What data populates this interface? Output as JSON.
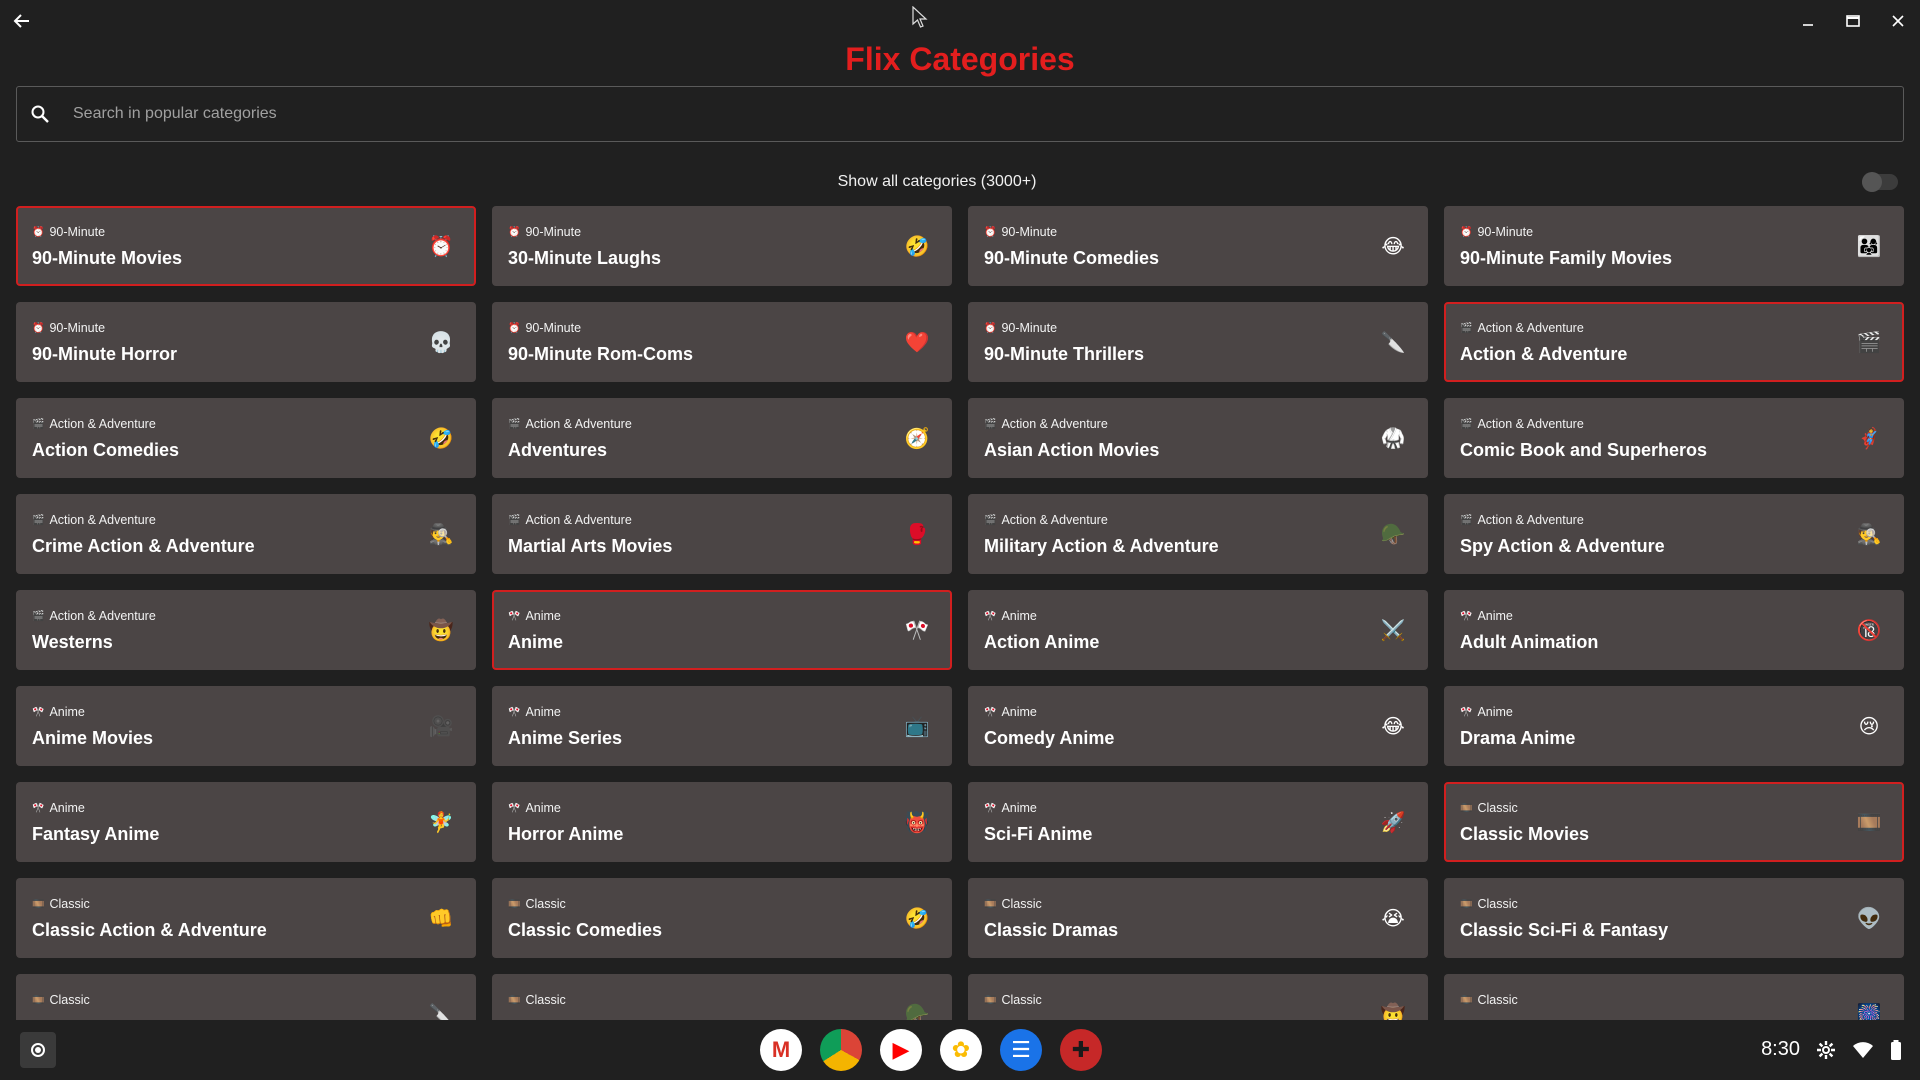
{
  "app": {
    "title": "Flix Categories"
  },
  "search": {
    "placeholder": "Search in popular categories"
  },
  "toggle": {
    "label": "Show all categories (3000+)",
    "on": false
  },
  "colors": {
    "accent": "#e31e1e",
    "card_bg": "#4b4545",
    "selected_border": "#d11f1f",
    "bg": "#202020"
  },
  "cards": [
    {
      "cat_icon": "⏰",
      "category": "90-Minute",
      "title": "90-Minute Movies",
      "emoji": "⏰",
      "icon_name": "alarm-clock-icon",
      "selected": true
    },
    {
      "cat_icon": "⏰",
      "category": "90-Minute",
      "title": "30-Minute Laughs",
      "emoji": "🤣",
      "icon_name": "rofl-face-icon",
      "selected": false
    },
    {
      "cat_icon": "⏰",
      "category": "90-Minute",
      "title": "90-Minute Comedies",
      "emoji": "😂",
      "icon_name": "laughing-face-icon",
      "selected": false
    },
    {
      "cat_icon": "⏰",
      "category": "90-Minute",
      "title": "90-Minute Family Movies",
      "emoji": "👨‍👩‍👧",
      "icon_name": "family-icon",
      "selected": false
    },
    {
      "cat_icon": "⏰",
      "category": "90-Minute",
      "title": "90-Minute Horror",
      "emoji": "💀",
      "icon_name": "skull-icon",
      "selected": false
    },
    {
      "cat_icon": "⏰",
      "category": "90-Minute",
      "title": " 90-Minute Rom-Coms",
      "emoji": "❤️",
      "icon_name": "heart-icon",
      "selected": false
    },
    {
      "cat_icon": "⏰",
      "category": "90-Minute",
      "title": " 90-Minute Thrillers",
      "emoji": "🔪",
      "icon_name": "knife-icon",
      "selected": false
    },
    {
      "cat_icon": "🎬",
      "category": "Action & Adventure",
      "title": "Action & Adventure",
      "emoji": "🎬",
      "icon_name": "clapperboard-icon",
      "selected": true
    },
    {
      "cat_icon": "🎬",
      "category": "Action & Adventure",
      "title": "Action Comedies",
      "emoji": "🤣",
      "icon_name": "rofl-face-icon",
      "selected": false
    },
    {
      "cat_icon": "🎬",
      "category": "Action & Adventure",
      "title": "Adventures",
      "emoji": "🧭",
      "icon_name": "compass-icon",
      "selected": false
    },
    {
      "cat_icon": "🎬",
      "category": "Action & Adventure",
      "title": "Asian Action Movies",
      "emoji": "🥋",
      "icon_name": "martial-arts-uniform-icon",
      "selected": false
    },
    {
      "cat_icon": "🎬",
      "category": "Action & Adventure",
      "title": "Comic Book and Superheros",
      "emoji": "🦸",
      "icon_name": "superhero-icon",
      "selected": false
    },
    {
      "cat_icon": "🎬",
      "category": "Action & Adventure",
      "title": "Crime Action & Adventure",
      "emoji": "🕵️",
      "icon_name": "detective-icon",
      "selected": false
    },
    {
      "cat_icon": "🎬",
      "category": "Action & Adventure",
      "title": "Martial Arts Movies",
      "emoji": "🥊",
      "icon_name": "boxing-glove-icon",
      "selected": false
    },
    {
      "cat_icon": "🎬",
      "category": "Action & Adventure",
      "title": "Military Action & Adventure",
      "emoji": "🪖",
      "icon_name": "military-helmet-icon",
      "selected": false
    },
    {
      "cat_icon": "🎬",
      "category": "Action & Adventure",
      "title": "Spy Action & Adventure",
      "emoji": "🕵️",
      "icon_name": "spy-icon",
      "selected": false
    },
    {
      "cat_icon": "🎬",
      "category": "Action & Adventure",
      "title": "Westerns",
      "emoji": "🤠",
      "icon_name": "cowboy-face-icon",
      "selected": false
    },
    {
      "cat_icon": "🎌",
      "category": "Anime",
      "title": "Anime",
      "emoji": "🎌",
      "icon_name": "crossed-flags-icon",
      "selected": true
    },
    {
      "cat_icon": "🎌",
      "category": "Anime",
      "title": "Action Anime",
      "emoji": "⚔️",
      "icon_name": "crossed-swords-icon",
      "selected": false
    },
    {
      "cat_icon": "🎌",
      "category": "Anime",
      "title": "Adult Animation",
      "emoji": "🔞",
      "icon_name": "no-under-18-icon",
      "selected": false
    },
    {
      "cat_icon": "🎌",
      "category": "Anime",
      "title": "Anime Movies",
      "emoji": "🎥",
      "icon_name": "movie-camera-icon",
      "selected": false
    },
    {
      "cat_icon": "🎌",
      "category": "Anime",
      "title": "Anime Series",
      "emoji": "📺",
      "icon_name": "television-icon",
      "selected": false
    },
    {
      "cat_icon": "🎌",
      "category": "Anime",
      "title": "Comedy Anime",
      "emoji": "😂",
      "icon_name": "laughing-face-icon",
      "selected": false
    },
    {
      "cat_icon": "🎌",
      "category": "Anime",
      "title": "Drama Anime",
      "emoji": "😢",
      "icon_name": "crying-face-icon",
      "selected": false
    },
    {
      "cat_icon": "🎌",
      "category": "Anime",
      "title": "Fantasy Anime",
      "emoji": "🧚",
      "icon_name": "fairy-icon",
      "selected": false
    },
    {
      "cat_icon": "🎌",
      "category": "Anime",
      "title": "Horror Anime",
      "emoji": "👹",
      "icon_name": "ogre-icon",
      "selected": false
    },
    {
      "cat_icon": "🎌",
      "category": "Anime",
      "title": "Sci-Fi Anime",
      "emoji": "🚀",
      "icon_name": "rocket-icon",
      "selected": false
    },
    {
      "cat_icon": "🎞️",
      "category": "Classic",
      "title": "Classic Movies",
      "emoji": "🎞️",
      "icon_name": "film-frames-icon",
      "selected": true
    },
    {
      "cat_icon": "🎞️",
      "category": "Classic",
      "title": "Classic Action & Adventure",
      "emoji": "👊",
      "icon_name": "fist-icon",
      "selected": false
    },
    {
      "cat_icon": "🎞️",
      "category": "Classic",
      "title": "Classic Comedies",
      "emoji": "🤣",
      "icon_name": "rofl-face-icon",
      "selected": false
    },
    {
      "cat_icon": "🎞️",
      "category": "Classic",
      "title": "Classic Dramas",
      "emoji": "😭",
      "icon_name": "loudly-crying-face-icon",
      "selected": false
    },
    {
      "cat_icon": "🎞️",
      "category": "Classic",
      "title": "Classic Sci-Fi & Fantasy",
      "emoji": "👽",
      "icon_name": "alien-icon",
      "selected": false
    },
    {
      "cat_icon": "🎞️",
      "category": "Classic",
      "title": "",
      "emoji": "🔪",
      "icon_name": "knife-icon",
      "selected": false
    },
    {
      "cat_icon": "🎞️",
      "category": "Classic",
      "title": "",
      "emoji": "🪖",
      "icon_name": "military-helmet-icon",
      "selected": false
    },
    {
      "cat_icon": "🎞️",
      "category": "Classic",
      "title": "",
      "emoji": "🤠",
      "icon_name": "cowboy-face-icon",
      "selected": false
    },
    {
      "cat_icon": "🎞️",
      "category": "Classic",
      "title": "",
      "emoji": "🎆",
      "icon_name": "fireworks-icon",
      "selected": false
    }
  ],
  "taskbar": {
    "apps": [
      {
        "name": "gmail-icon",
        "glyph": "M",
        "bg": "#ffffff",
        "fg": "#d93025"
      },
      {
        "name": "chrome-icon",
        "glyph": "",
        "bg": "conic-gradient(#db4437 0 33%, #f4b400 0 66%, #0f9d58 0)",
        "fg": "#fff"
      },
      {
        "name": "youtube-icon",
        "glyph": "▶",
        "bg": "#ffffff",
        "fg": "#ff0000"
      },
      {
        "name": "photos-icon",
        "glyph": "✿",
        "bg": "#ffffff",
        "fg": "#fbbc04"
      },
      {
        "name": "messages-icon",
        "glyph": "☰",
        "bg": "#1a73e8",
        "fg": "#ffffff"
      },
      {
        "name": "flix-categories-icon",
        "glyph": "✚",
        "bg": "#c62828",
        "fg": "#1a1a1a"
      }
    ],
    "clock": "8:30"
  }
}
